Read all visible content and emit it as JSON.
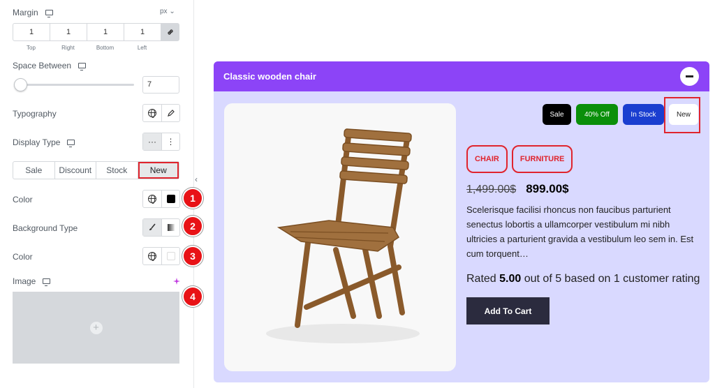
{
  "panel": {
    "margin": {
      "label": "Margin",
      "unit": "px ⌄",
      "top": "1",
      "right": "1",
      "bottom": "1",
      "left": "1",
      "top_label": "Top",
      "right_label": "Right",
      "bottom_label": "Bottom",
      "left_label": "Left"
    },
    "space_between": {
      "label": "Space Between",
      "value": "7",
      "level": 0
    },
    "typography_label": "Typography",
    "display_type": {
      "label": "Display Type",
      "btn1": "···",
      "btn2": "⋮"
    },
    "tabs": [
      "Sale",
      "Discount",
      "Stock",
      "New"
    ],
    "active_tab": "New",
    "color_label": "Color",
    "background_type_label": "Background Type",
    "color2_label": "Color",
    "image_label": "Image",
    "image_plus": "+",
    "collapse": "‹",
    "callouts": [
      "1",
      "2",
      "3",
      "4"
    ]
  },
  "product": {
    "title": "Classic wooden chair",
    "badges": [
      "Sale",
      "40% Off",
      "In Stock",
      "New"
    ],
    "categories": [
      "CHAIR",
      "FURNITURE"
    ],
    "old_price": "1,499.00$",
    "price": "899.00$",
    "description": "Scelerisque facilisi rhoncus non faucibus parturient senectus lobortis a ullamcorper vestibulum mi nibh ultricies a parturient gravida a vestibulum leo sem in. Est cum torquent…",
    "rating_pre": "Rated ",
    "rating_value": "5.00",
    "rating_post": " out of 5 based on 1 customer rating",
    "add_to_cart": "Add To Cart"
  },
  "colors": {
    "header": "#8c44f7",
    "card_bg": "#d9d9ff",
    "highlight": "#e0242d",
    "callout": "#e81216",
    "cart_btn": "#2b2b3e"
  }
}
